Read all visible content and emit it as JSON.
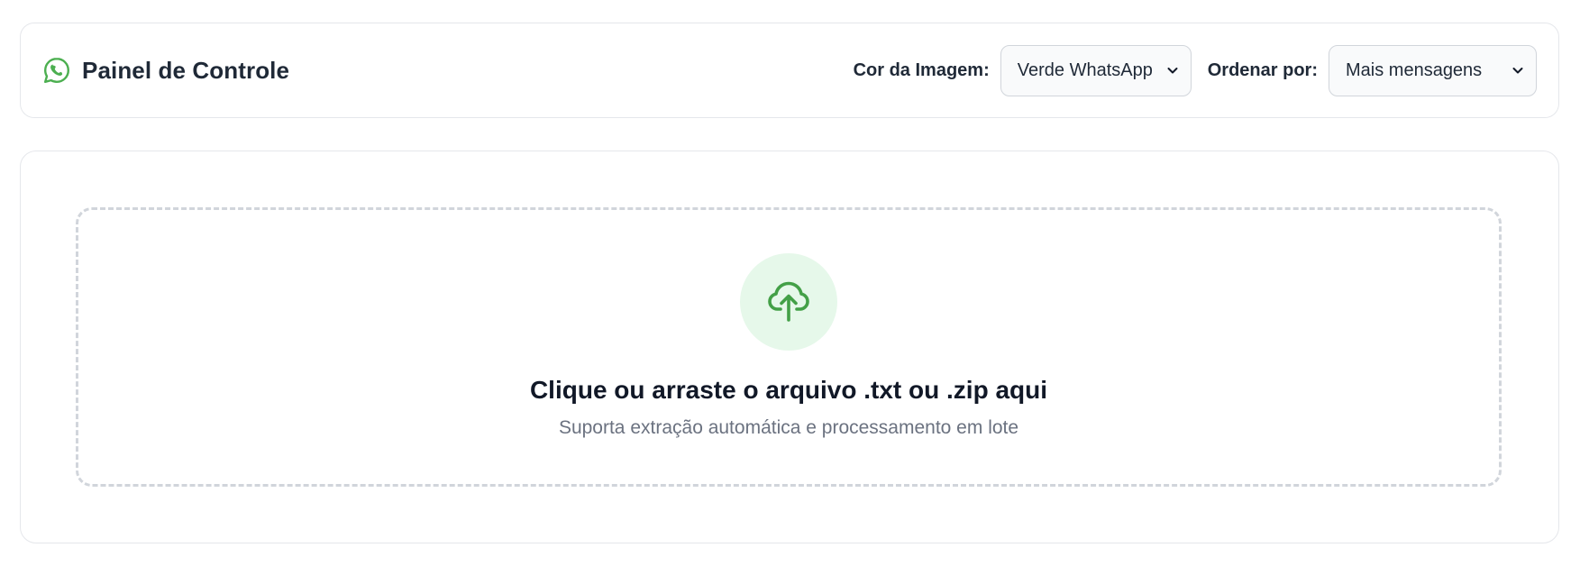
{
  "header": {
    "title": "Painel de Controle",
    "icon": "whatsapp-icon",
    "icon_color": "#4caf50"
  },
  "controls": {
    "color_label": "Cor da Imagem:",
    "color_selected": "Verde WhatsApp",
    "order_label": "Ordenar por:",
    "order_selected": "Mais mensagens"
  },
  "upload": {
    "icon": "cloud-upload-icon",
    "icon_color": "#43a047",
    "circle_color": "#e6f8ea",
    "title": "Clique ou arraste o arquivo .txt ou .zip aqui",
    "subtitle": "Suporta extração automática e processamento em lote"
  }
}
